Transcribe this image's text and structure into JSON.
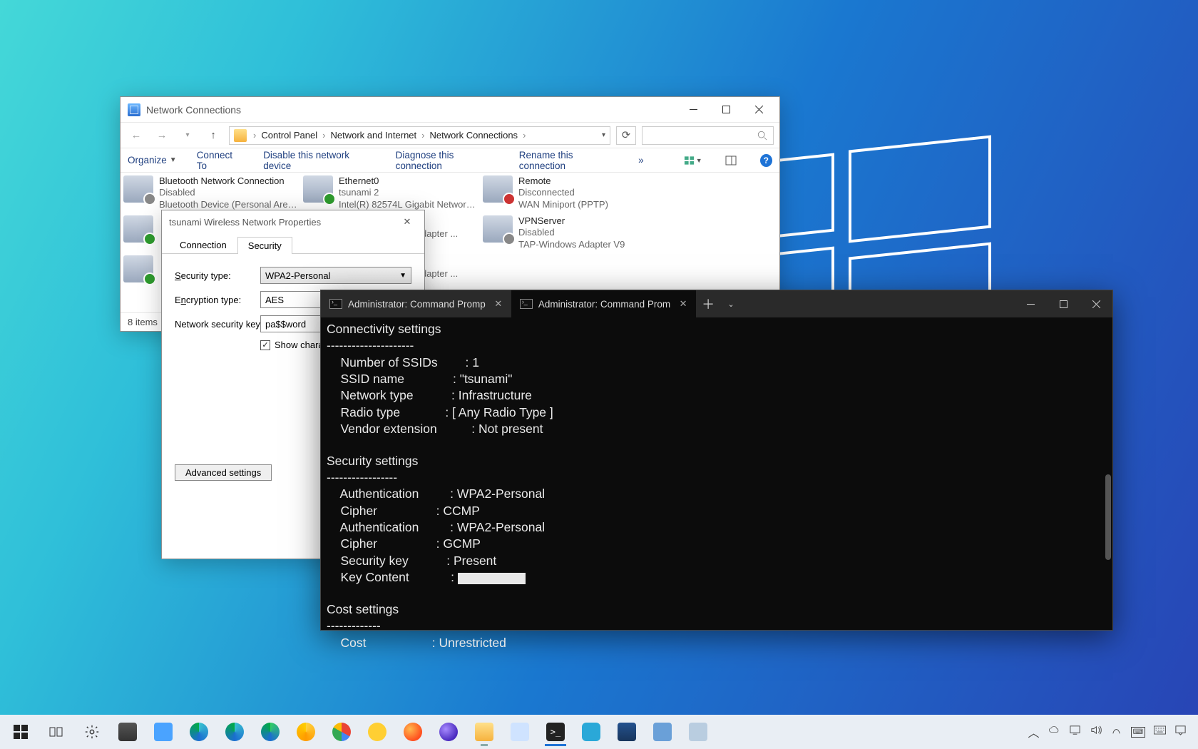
{
  "netwin": {
    "title": "Network Connections",
    "breadcrumb": [
      "Control Panel",
      "Network and Internet",
      "Network Connections"
    ],
    "cmdbar": {
      "organize": "Organize",
      "connect_to": "Connect To",
      "disable": "Disable this network device",
      "diagnose": "Diagnose this connection",
      "rename": "Rename this connection"
    },
    "status": "8 items",
    "connections": [
      {
        "name": "Bluetooth Network Connection",
        "line2": "Disabled",
        "line3": "Bluetooth Device (Personal Area ...",
        "cls": "bt disabled"
      },
      {
        "name": "Ethernet0",
        "line2": "tsunami 2",
        "line3": "Intel(R) 82574L Gigabit Network C...",
        "cls": ""
      },
      {
        "name": "Remote",
        "line2": "Disconnected",
        "line3": "WAN Miniport (PPTP)",
        "cls": "dc"
      },
      {
        "name": "",
        "line2": "",
        "line3": "",
        "cls": ""
      },
      {
        "name": "",
        "line2": "",
        "line3": "rnet Adapter ...",
        "cls": ""
      },
      {
        "name": "VPNServer",
        "line2": "Disabled",
        "line3": "TAP-Windows Adapter V9",
        "cls": "disabled"
      },
      {
        "name": "",
        "line2": "",
        "line3": "",
        "cls": ""
      },
      {
        "name": "",
        "line2": "",
        "line3": "rnet Adapter ...",
        "cls": ""
      }
    ]
  },
  "props": {
    "title": "tsunami Wireless Network Properties",
    "tabs": {
      "connection": "Connection",
      "security": "Security"
    },
    "labels": {
      "sec_type": "Security type:",
      "enc_type": "Encryption type:",
      "key": "Network security key",
      "show": "Show characters",
      "adv": "Advanced settings"
    },
    "values": {
      "sec_type": "WPA2-Personal",
      "enc_type": "AES",
      "key": "pa$$word",
      "show_checked": "✓"
    }
  },
  "term": {
    "tab1": "Administrator: Command Promp",
    "tab2": "Administrator: Command Prom",
    "lines": {
      "h1": "Connectivity settings",
      "d1": "---------------------",
      "l1a": "    Number of SSIDs        : ",
      "l1b": "1",
      "l2a": "    SSID name              : ",
      "l2b": "\"tsunami\"",
      "l3a": "    Network type           : ",
      "l3b": "Infrastructure",
      "l4a": "    Radio type             : ",
      "l4b": "[ Any Radio Type ]",
      "l5a": "    Vendor extension          : ",
      "l5b": "Not present",
      "h2": "Security settings",
      "d2": "-----------------",
      "s1a": "    Authentication         : ",
      "s1b": "WPA2-Personal",
      "s2a": "    Cipher                 : ",
      "s2b": "CCMP",
      "s3a": "    Authentication         : ",
      "s3b": "WPA2-Personal",
      "s4a": "    Cipher                 : ",
      "s4b": "GCMP",
      "s5a": "    Security key           : ",
      "s5b": "Present",
      "s6a": "    Key Content            : ",
      "h3": "Cost settings",
      "d3": "-------------",
      "c1a": "    Cost                   : ",
      "c1b": "Unrestricted"
    }
  }
}
